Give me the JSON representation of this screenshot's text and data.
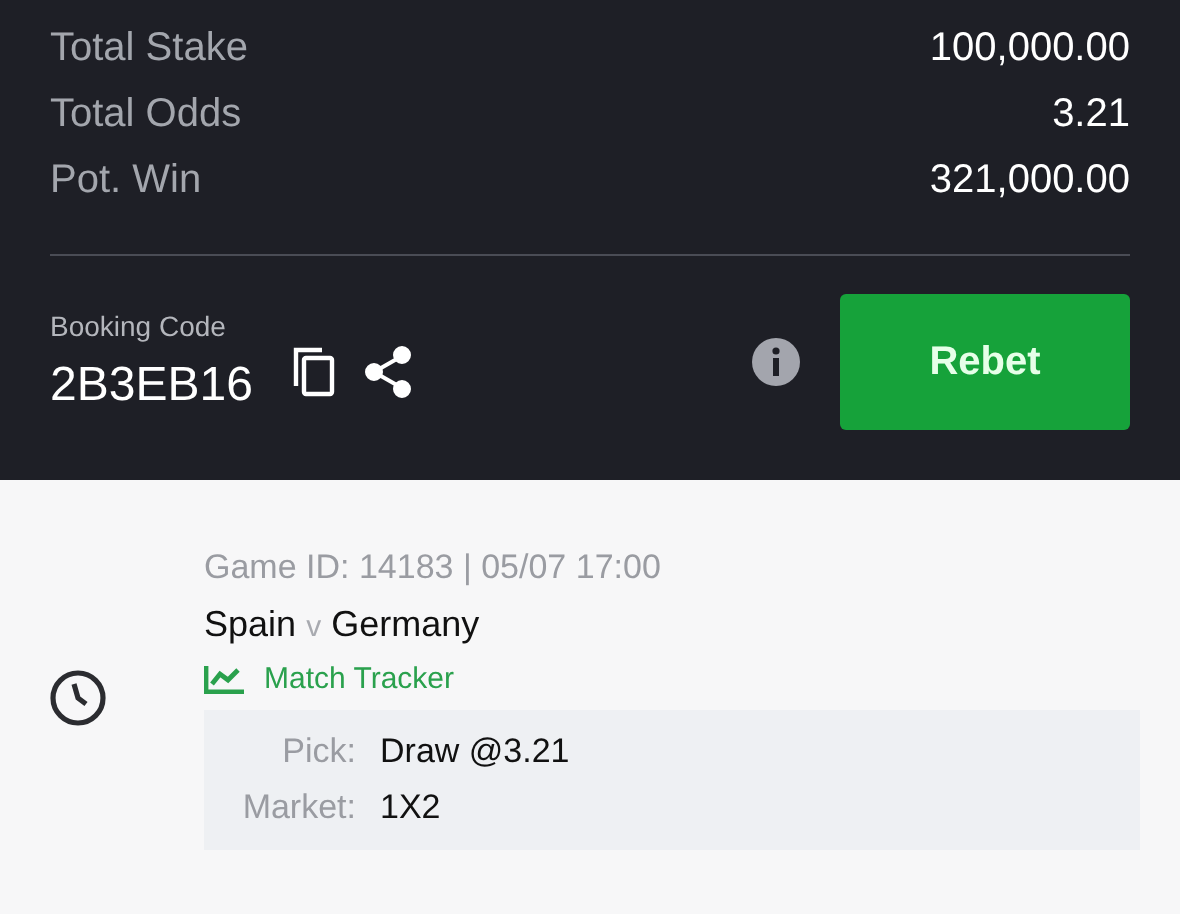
{
  "summary": [
    {
      "label": "Total Stake",
      "value": "100,000.00"
    },
    {
      "label": "Total Odds",
      "value": "3.21"
    },
    {
      "label": "Pot. Win",
      "value": "321,000.00"
    }
  ],
  "booking": {
    "label": "Booking Code",
    "code": "2B3EB16",
    "button": "Rebet"
  },
  "game": {
    "info": "Game ID: 14183 | 05/07 17:00",
    "home": "Spain",
    "separator": "v",
    "away": "Germany",
    "tracker": "Match Tracker",
    "details": [
      {
        "label": "Pick:",
        "value": "Draw @3.21"
      },
      {
        "label": "Market:",
        "value": "1X2"
      }
    ]
  }
}
